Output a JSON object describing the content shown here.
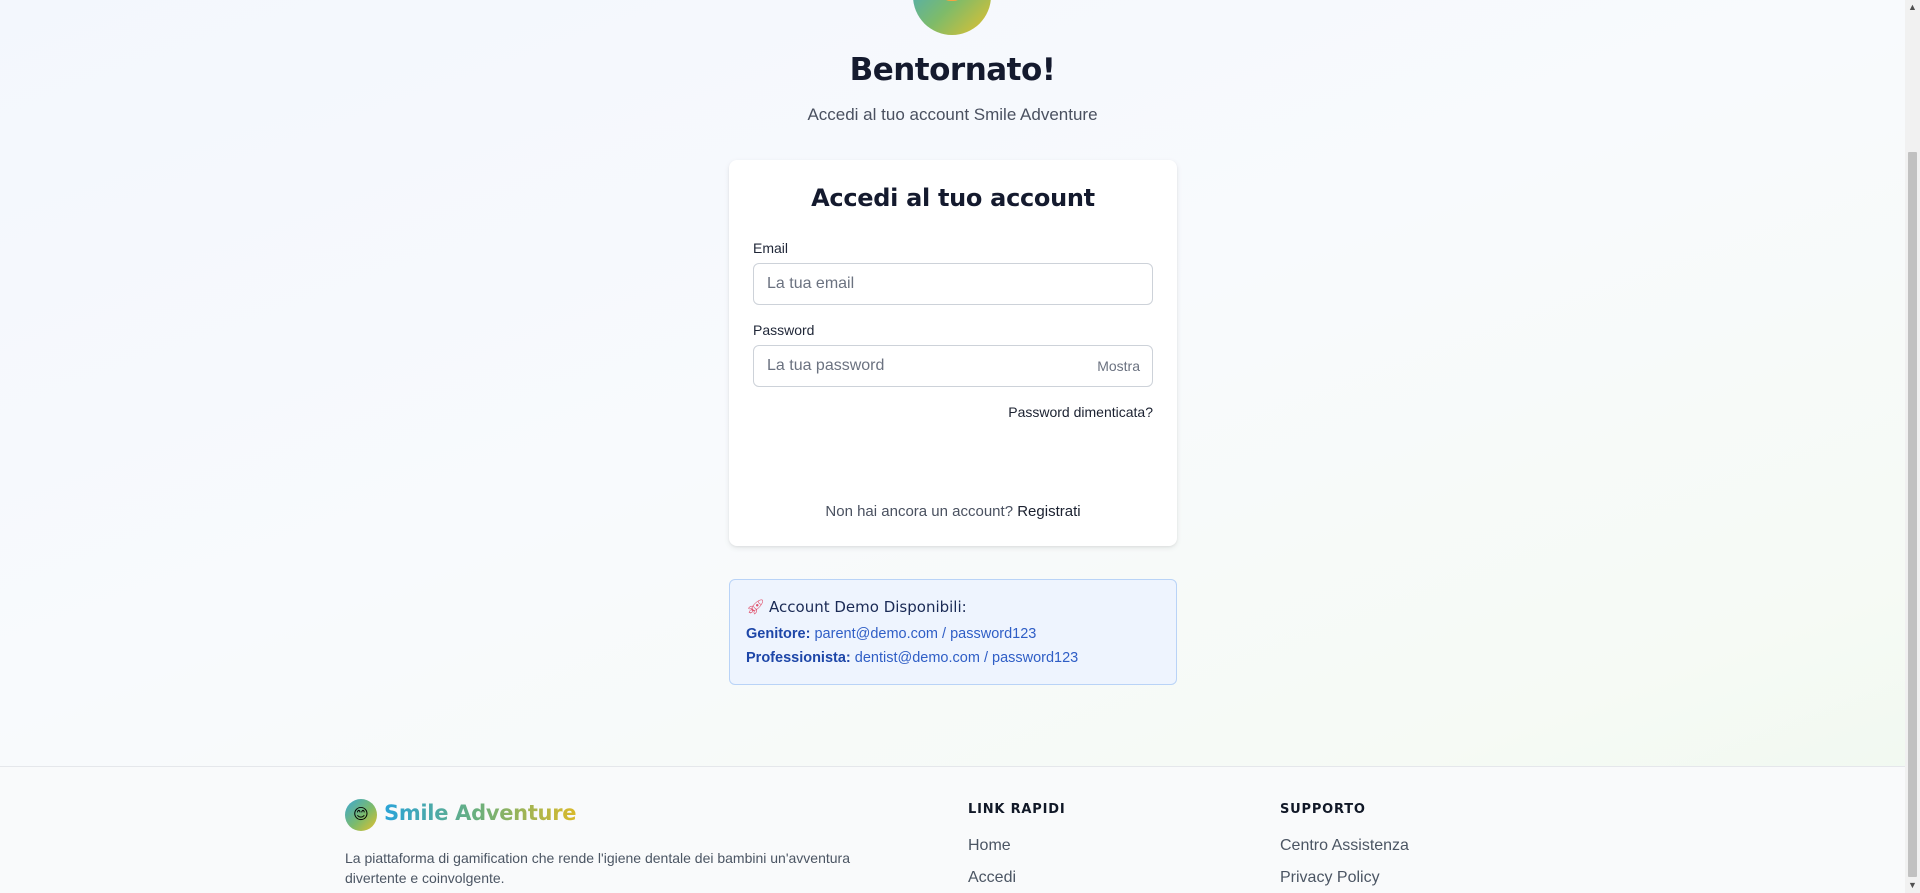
{
  "hero": {
    "title": "Bentornato!",
    "subtitle": "Accedi al tuo account Smile Adventure"
  },
  "login_card": {
    "title": "Accedi al tuo account",
    "email_label": "Email",
    "email_placeholder": "La tua email",
    "email_value": "",
    "password_label": "Password",
    "password_placeholder": "La tua password",
    "password_value": "",
    "show_label": "Mostra",
    "forgot_label": "Password dimenticata?",
    "no_account_text": "Non hai ancora un account?",
    "register_label": "Registrati"
  },
  "demo": {
    "icon": "rocket-icon",
    "title": "Account Demo Disponibili:",
    "accounts": [
      {
        "role": "Genitore:",
        "credentials": "parent@demo.com / password123"
      },
      {
        "role": "Professionista:",
        "credentials": "dentist@demo.com / password123"
      }
    ]
  },
  "footer": {
    "brand": "Smile Adventure",
    "logo_emoji": "😊",
    "description": "La piattaforma di gamification che rende l'igiene dentale dei bambini un'avventura divertente e coinvolgente.",
    "quick_links_title": "LINK RAPIDI",
    "quick_links": [
      "Home",
      "Accedi"
    ],
    "support_title": "SUPPORTO",
    "support_links": [
      "Centro Assistenza",
      "Privacy Policy"
    ]
  },
  "colors": {
    "heading": "#141a2e",
    "demo_background": "#eef4fe",
    "demo_border": "#b9d3f7",
    "demo_text": "#2f5ec6"
  }
}
